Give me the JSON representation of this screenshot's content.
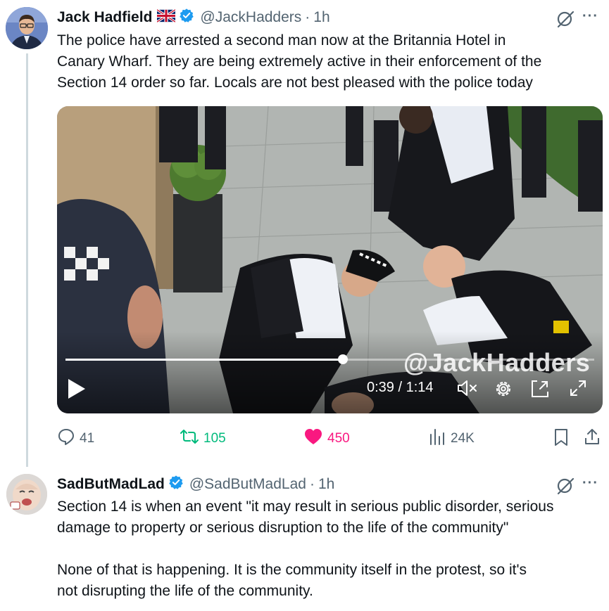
{
  "post": {
    "author_name": "Jack Hadfield",
    "author_handle": "@JackHadders",
    "separator": "·",
    "time": "1h",
    "text_lines": [
      "The police have arrested a second man now at the Britannia Hotel in",
      "Canary Wharf. They are being extremely active in their enforcement of the",
      "Section 14 order so far. Locals are not best pleased with the police today"
    ],
    "media": {
      "watermark": "@JackHadders",
      "timecode": "0:39 / 1:14",
      "progress_fraction": 0.525
    },
    "stats": {
      "replies": "41",
      "reposts": "105",
      "likes": "450",
      "views": "24K"
    }
  },
  "reply": {
    "author_name": "SadButMadLad",
    "author_handle": "@SadButMadLad",
    "separator": "·",
    "time": "1h",
    "paragraph1_lines": [
      "Section 14 is when an event \"it may result in serious public disorder, serious",
      "damage to property or serious disruption to the life of the community\""
    ],
    "paragraph2_lines": [
      "None of that is happening. It is the community itself in the protest, so it's",
      "not disrupting the life of the community."
    ]
  },
  "colors": {
    "text": "#0f1419",
    "secondary": "#536471",
    "verified": "#1d9bf0",
    "repost": "#00ba7c",
    "like": "#f91880",
    "thread_line": "#cfd9de"
  },
  "icons": [
    "uk-flag-icon",
    "verified-icon",
    "grok-icon",
    "more-icon",
    "play-icon",
    "mute-icon",
    "settings-icon",
    "pip-icon",
    "fullscreen-icon",
    "reply-icon",
    "repost-icon",
    "like-icon",
    "views-icon",
    "bookmark-icon",
    "share-icon"
  ]
}
